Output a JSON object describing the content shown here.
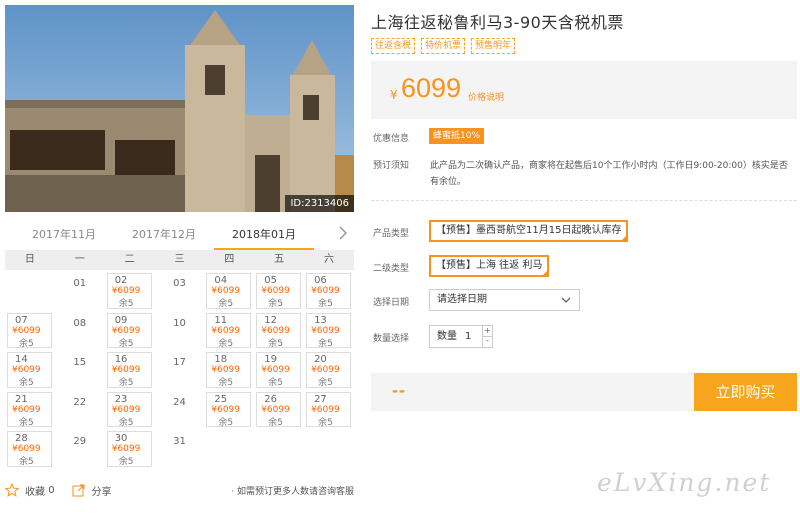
{
  "photo": {
    "id_label": "ID:2313406"
  },
  "calendar": {
    "months": [
      {
        "label": "2017年11月",
        "active": false
      },
      {
        "label": "2017年12月",
        "active": false
      },
      {
        "label": "2018年01月",
        "active": true
      }
    ],
    "next_icon": "chevron-right-icon",
    "weekdays": [
      "日",
      "一",
      "二",
      "三",
      "四",
      "五",
      "六"
    ],
    "leading_blanks": 1,
    "days": [
      {
        "num": "01",
        "avail": false
      },
      {
        "num": "02",
        "avail": true,
        "price": "¥6099",
        "left": "余5"
      },
      {
        "num": "03",
        "avail": false
      },
      {
        "num": "04",
        "avail": true,
        "price": "¥6099",
        "left": "余5"
      },
      {
        "num": "05",
        "avail": true,
        "price": "¥6099",
        "left": "余5"
      },
      {
        "num": "06",
        "avail": true,
        "price": "¥6099",
        "left": "余5"
      },
      {
        "num": "07",
        "avail": true,
        "price": "¥6099",
        "left": "余5"
      },
      {
        "num": "08",
        "avail": false
      },
      {
        "num": "09",
        "avail": true,
        "price": "¥6099",
        "left": "余5"
      },
      {
        "num": "10",
        "avail": false
      },
      {
        "num": "11",
        "avail": true,
        "price": "¥6099",
        "left": "余5"
      },
      {
        "num": "12",
        "avail": true,
        "price": "¥6099",
        "left": "余5"
      },
      {
        "num": "13",
        "avail": true,
        "price": "¥6099",
        "left": "余5"
      },
      {
        "num": "14",
        "avail": true,
        "price": "¥6099",
        "left": "余5"
      },
      {
        "num": "15",
        "avail": false
      },
      {
        "num": "16",
        "avail": true,
        "price": "¥6099",
        "left": "余5"
      },
      {
        "num": "17",
        "avail": false
      },
      {
        "num": "18",
        "avail": true,
        "price": "¥6099",
        "left": "余5"
      },
      {
        "num": "19",
        "avail": true,
        "price": "¥6099",
        "left": "余5"
      },
      {
        "num": "20",
        "avail": true,
        "price": "¥6099",
        "left": "余5"
      },
      {
        "num": "21",
        "avail": true,
        "price": "¥6099",
        "left": "余5"
      },
      {
        "num": "22",
        "avail": false
      },
      {
        "num": "23",
        "avail": true,
        "price": "¥6099",
        "left": "余5"
      },
      {
        "num": "24",
        "avail": false
      },
      {
        "num": "25",
        "avail": true,
        "price": "¥6099",
        "left": "余5"
      },
      {
        "num": "26",
        "avail": true,
        "price": "¥6099",
        "left": "余5"
      },
      {
        "num": "27",
        "avail": true,
        "price": "¥6099",
        "left": "余5"
      },
      {
        "num": "28",
        "avail": true,
        "price": "¥6099",
        "left": "余5"
      },
      {
        "num": "29",
        "avail": false
      },
      {
        "num": "30",
        "avail": true,
        "price": "¥6099",
        "left": "余5"
      },
      {
        "num": "31",
        "avail": false
      }
    ]
  },
  "actions": {
    "favorite_label": "收藏",
    "favorite_count": "0",
    "share_label": "分享",
    "note": "· 如需预订更多人数请咨询客服"
  },
  "product": {
    "title": "上海往返秘鲁利马3-90天含税机票",
    "tags": [
      "往返含税",
      "特价机票",
      "预售明年"
    ],
    "price_symbol": "¥",
    "price": "6099",
    "price_note": "价格说明"
  },
  "info": {
    "promo_label": "优惠信息",
    "promo_value": "蜂蜜抵10%",
    "notice_label": "预订须知",
    "notice_text": "此产品为二次确认产品，商家将在起售后10个工作小时内（工作日9:00-20:00）核实是否有余位。"
  },
  "options": {
    "type_label": "产品类型",
    "type_value": "【预售】墨西哥航空11月15日起晚认库存",
    "subtype_label": "二级类型",
    "subtype_value": "【预售】上海 往返 利马",
    "date_label": "选择日期",
    "date_placeholder": "请选择日期",
    "qty_label": "数量选择",
    "qty_prefix": "数量",
    "qty_value": "1",
    "qty_up": "+",
    "qty_down": "-"
  },
  "buy": {
    "total": "--",
    "button_label": "立即购买"
  },
  "watermark": "eLvXing.net",
  "colors": {
    "accent": "#f7931e",
    "button": "#f7a51c"
  }
}
